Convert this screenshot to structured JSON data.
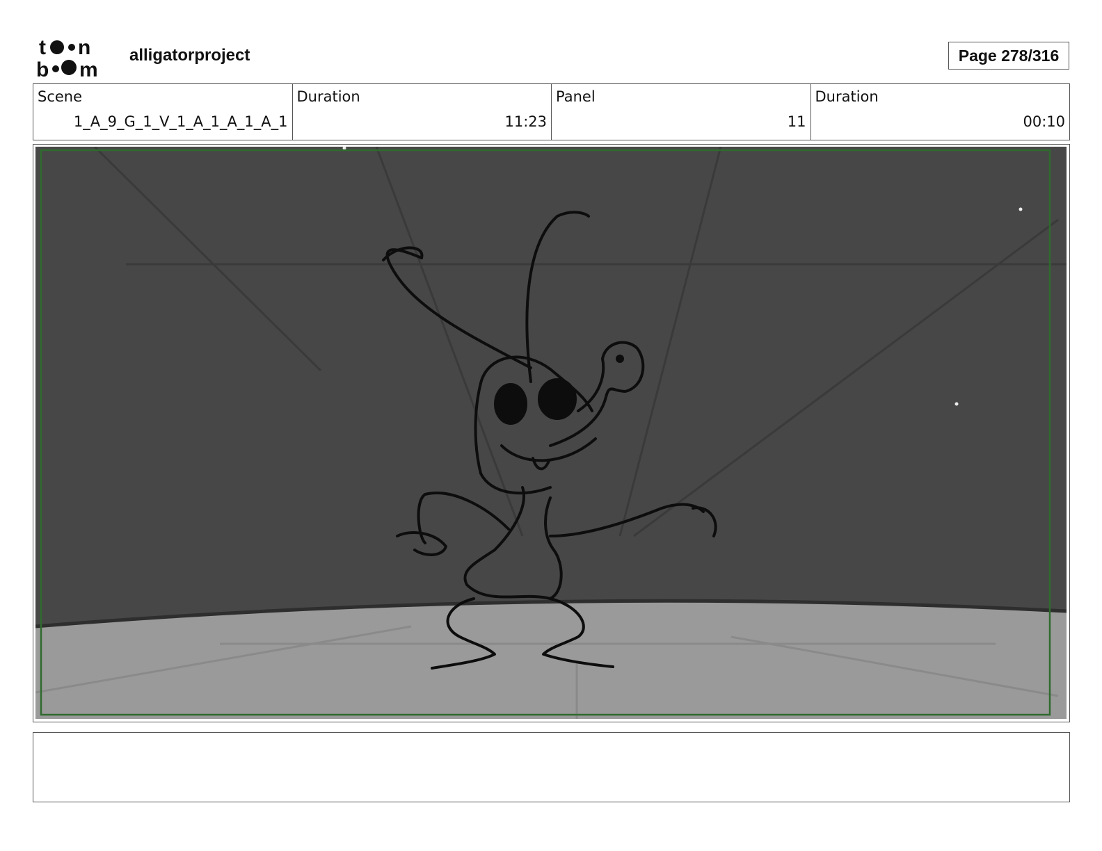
{
  "header": {
    "logo_text": "toon boom",
    "project": "alligatorproject",
    "page": "Page 278/316"
  },
  "info": {
    "scene_label": "Scene",
    "scene_value": "1_A_9_G_1_V_1_A_1_A_1_A_1",
    "scene_duration_label": "Duration",
    "scene_duration_value": "11:23",
    "panel_label": "Panel",
    "panel_value": "11",
    "panel_duration_label": "Duration",
    "panel_duration_value": "00:10"
  },
  "colors": {
    "sky": "#474747",
    "floor": "#9a9a9a",
    "frame_green": "#2f6a2f"
  },
  "notes": {
    "text": ""
  }
}
